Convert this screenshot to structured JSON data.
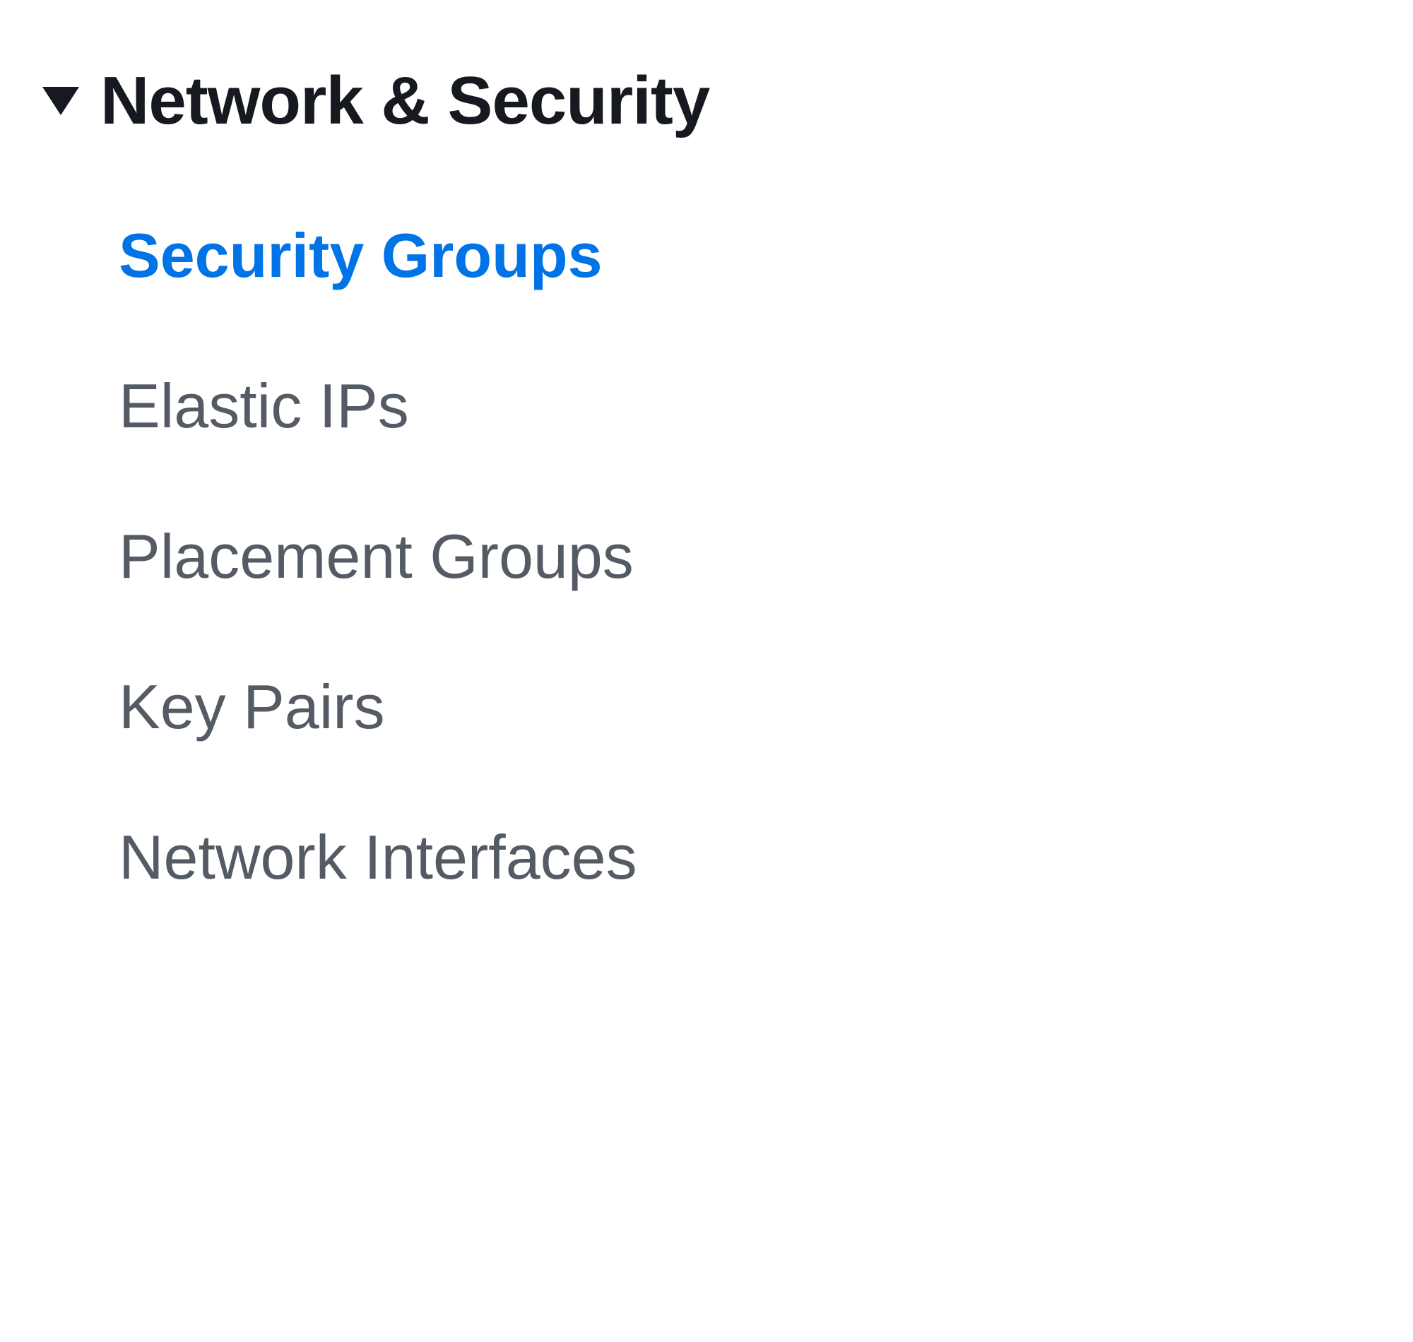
{
  "sidebar": {
    "section": {
      "title": "Network & Security",
      "expanded": true,
      "items": [
        {
          "label": "Security Groups",
          "active": true
        },
        {
          "label": "Elastic IPs",
          "active": false
        },
        {
          "label": "Placement Groups",
          "active": false
        },
        {
          "label": "Key Pairs",
          "active": false
        },
        {
          "label": "Network Interfaces",
          "active": false
        }
      ]
    }
  },
  "colors": {
    "link_active": "#0073e6",
    "text_heading": "#16191f",
    "text_body": "#545b64"
  }
}
